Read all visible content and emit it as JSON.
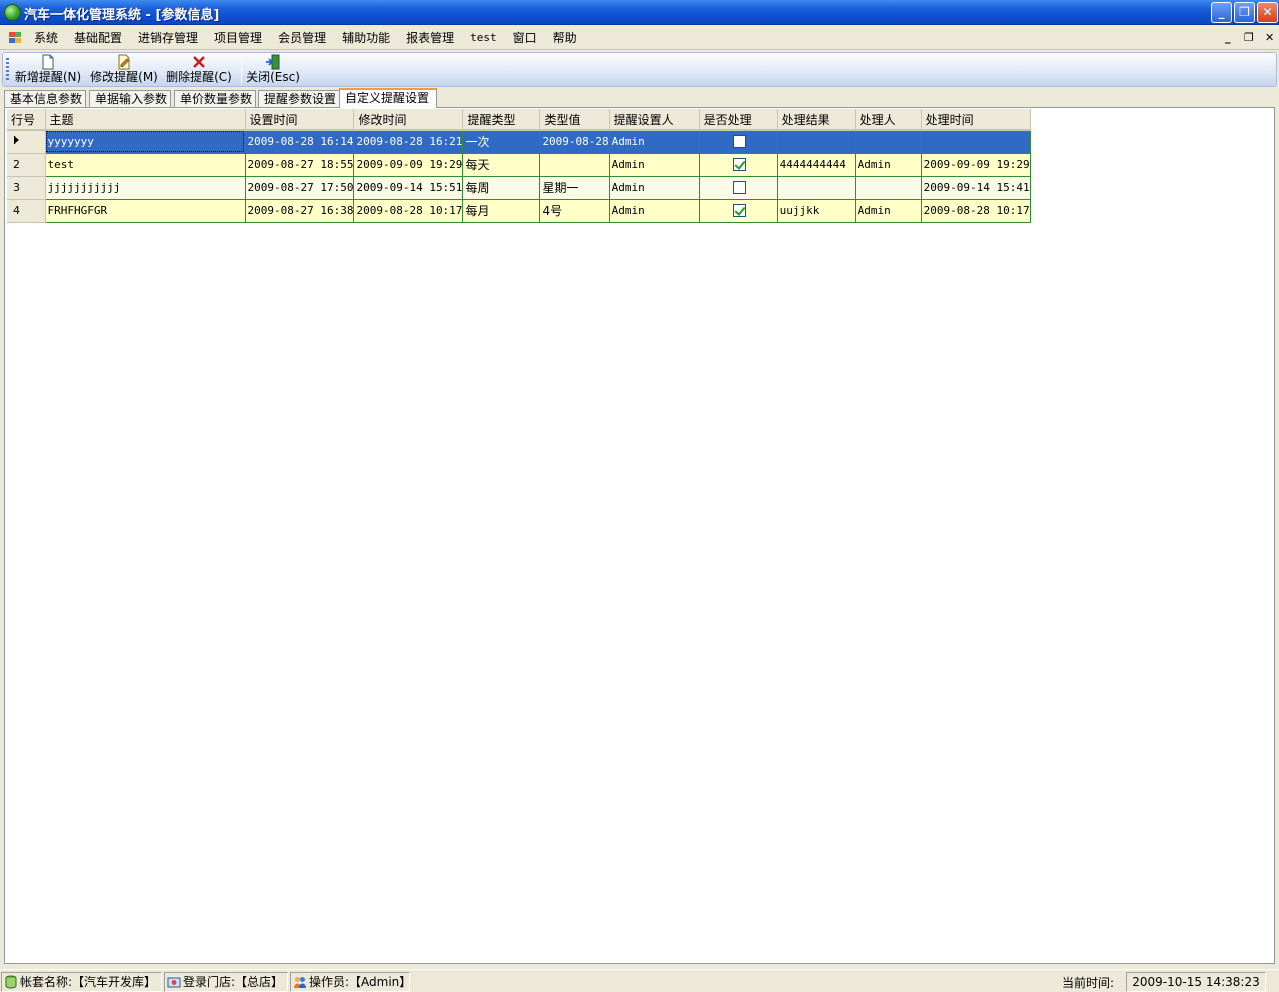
{
  "window": {
    "title": "汽车一体化管理系统 - [参数信息]",
    "controls": {
      "minimize": "_",
      "restore": "❐",
      "close": "✕"
    }
  },
  "menu": {
    "items": [
      "系统",
      "基础配置",
      "进销存管理",
      "项目管理",
      "会员管理",
      "辅助功能",
      "报表管理",
      "test",
      "窗口",
      "帮助"
    ],
    "mdi_controls": {
      "minimize": "_",
      "restore": "❐",
      "close": "✕"
    }
  },
  "toolbar": {
    "add_label": "新增提醒(N)",
    "edit_label": "修改提醒(M)",
    "delete_label": "删除提醒(C)",
    "close_label": "关闭(Esc)"
  },
  "tabs": [
    "基本信息参数",
    "单据输入参数",
    "单价数量参数",
    "提醒参数设置",
    "自定义提醒设置"
  ],
  "active_tab": 4,
  "grid": {
    "columns": [
      "行号",
      "主题",
      "设置时间",
      "修改时间",
      "提醒类型",
      "类型值",
      "提醒设置人",
      "是否处理",
      "处理结果",
      "处理人",
      "处理时间"
    ],
    "rows": [
      {
        "no": "",
        "subject": "yyyyyyy",
        "set_time": "2009-08-28 16:14",
        "mod_time": "2009-08-28 16:21",
        "type": "一次",
        "type_value": "2009-08-28",
        "setter": "Admin",
        "handled": false,
        "result": "",
        "handler": "",
        "handle_time": ""
      },
      {
        "no": "2",
        "subject": "test",
        "set_time": "2009-08-27 18:55",
        "mod_time": "2009-09-09 19:29",
        "type": "每天",
        "type_value": "",
        "setter": "Admin",
        "handled": true,
        "result": "4444444444",
        "handler": "Admin",
        "handle_time": "2009-09-09 19:29"
      },
      {
        "no": "3",
        "subject": "jjjjjjjjjjj",
        "set_time": "2009-08-27 17:50",
        "mod_time": "2009-09-14 15:51",
        "type": "每周",
        "type_value": "星期一",
        "setter": "Admin",
        "handled": false,
        "result": "",
        "handler": "",
        "handle_time": "2009-09-14 15:41"
      },
      {
        "no": "4",
        "subject": "FRHFHGFGR",
        "set_time": "2009-08-27 16:38",
        "mod_time": "2009-08-28 10:17",
        "type": "每月",
        "type_value": "4号",
        "setter": "Admin",
        "handled": true,
        "result": "uujjkk",
        "handler": "Admin",
        "handle_time": "2009-08-28 10:17"
      }
    ]
  },
  "status": {
    "account": "帐套名称:【汽车开发库】",
    "store": "登录门店:【总店】",
    "operator": "操作员:【Admin】",
    "time_label": "当前时间:",
    "time_value": "2009-10-15 14:38:23"
  },
  "colors": {
    "title_bar": "#0b4fd0",
    "selected_row": "#316ac5",
    "row_fill": "#ffffc8",
    "grid_line": "#2f8f2f",
    "active_tab_accent": "#e6a33a"
  },
  "icons": {
    "app": "car-system-app-icon",
    "add": "new-document-icon",
    "edit": "edit-document-icon",
    "delete": "red-x-icon",
    "close": "exit-door-icon",
    "row_pointer": "current-row-pointer-icon"
  }
}
